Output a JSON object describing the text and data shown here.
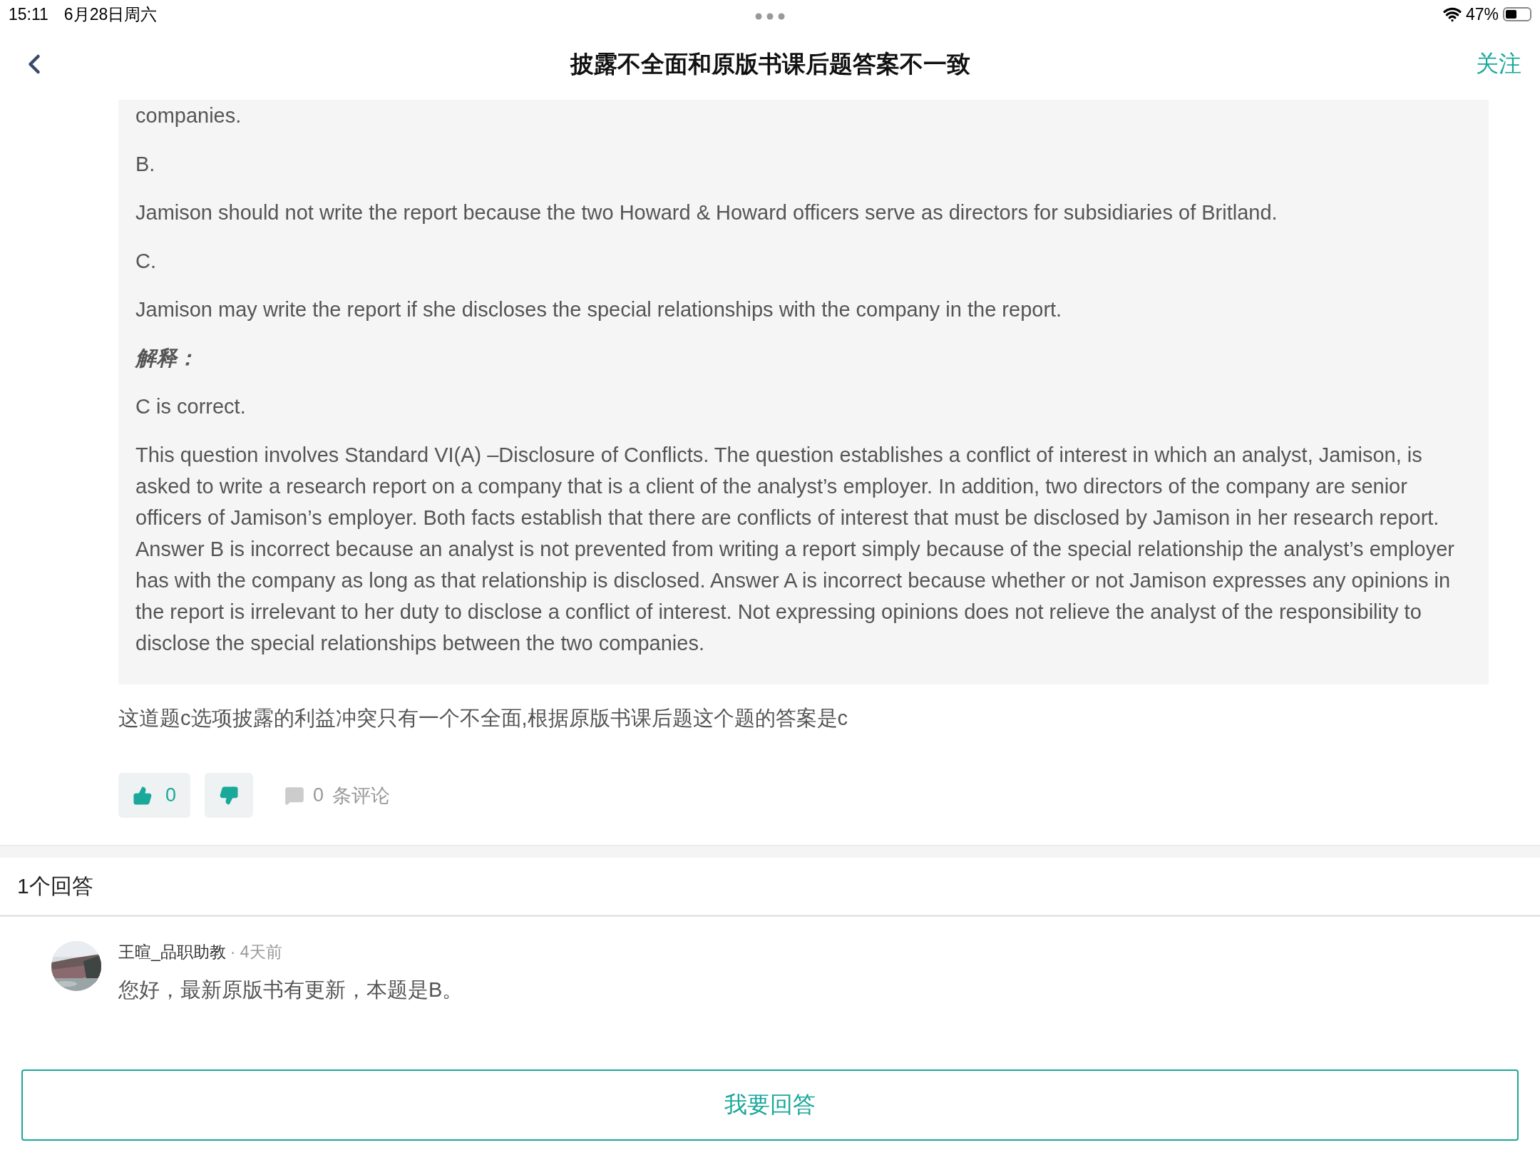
{
  "status_bar": {
    "time": "15:11",
    "date": "6月28日周六",
    "battery": "47%"
  },
  "nav": {
    "title": "披露不全面和原版书课后题答案不一致",
    "follow": "关注"
  },
  "question": {
    "paragraphs": [
      {
        "kind": "text",
        "text": "companies."
      },
      {
        "kind": "text",
        "text": "B."
      },
      {
        "kind": "text",
        "text": "Jamison should not write the report because the two Howard & Howard officers serve as directors for subsidiaries of Britland."
      },
      {
        "kind": "text",
        "text": "C."
      },
      {
        "kind": "text",
        "text": "Jamison may write the report if she discloses the special relationships with the company in the report."
      },
      {
        "kind": "heading",
        "text": "解释："
      },
      {
        "kind": "text",
        "text": "C is correct."
      },
      {
        "kind": "text",
        "text": "This question involves Standard VI(A) –Disclosure of Conflicts. The question establishes a conflict of interest in which an analyst, Jamison, is asked to write a research report on a company that is a client of the analyst’s employer. In addition, two directors of the company are senior officers of Jamison’s employer. Both facts establish that there are conflicts of interest that must be disclosed by Jamison in her research report. Answer B is incorrect because an analyst is not prevented from writing a report simply because of the special relationship the analyst’s employer has with the company as long as that relationship is disclosed. Answer A is incorrect because whether or not Jamison expresses any opinions in the report is irrelevant to her duty to disclose a conflict of interest. Not expressing opinions does not relieve the analyst of the responsibility to disclose the special relationships between the two companies."
      }
    ],
    "comment": "这道题c选项披露的利益冲突只有一个不全面,根据原版书课后题这个题的答案是c",
    "likes": "0",
    "comment_count": "0",
    "comment_label": "条评论"
  },
  "answers_header": "1个回答",
  "answers": [
    {
      "author": "王暄_品职助教",
      "time": "· 4天前",
      "text": "您好，最新原版书有更新，本题是B。"
    }
  ],
  "answer_button": "我要回答"
}
